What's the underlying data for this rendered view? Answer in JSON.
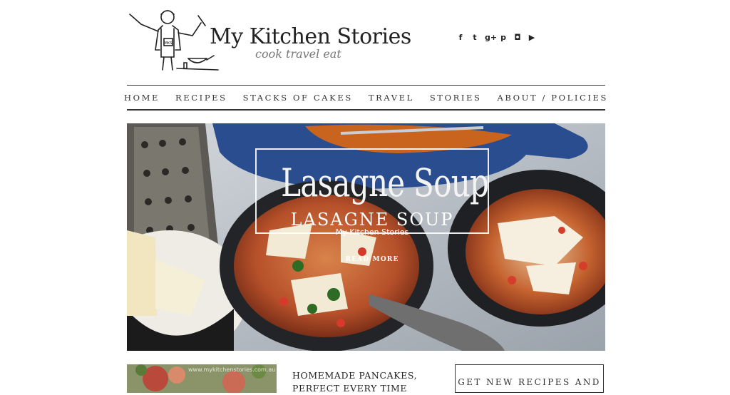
{
  "header": {
    "site_title": "My Kitchen Stories",
    "tagline": "cook travel eat",
    "logo_icon": "chef-illustration-icon",
    "apron_text": "MKS"
  },
  "social": [
    {
      "icon": "facebook-icon",
      "glyph": "f"
    },
    {
      "icon": "twitter-icon",
      "glyph": "t"
    },
    {
      "icon": "google-plus-icon",
      "glyph": "g+"
    },
    {
      "icon": "pinterest-icon",
      "glyph": "p"
    },
    {
      "icon": "instagram-icon",
      "glyph": "◘"
    },
    {
      "icon": "youtube-icon",
      "glyph": "▶"
    }
  ],
  "nav": {
    "items": [
      "HOME",
      "RECIPES",
      "STACKS OF CAKES",
      "TRAVEL",
      "STORIES",
      "ABOUT / POLICIES"
    ]
  },
  "hero": {
    "script_title": "Lasagne Soup",
    "title": "LASAGNE SOUP",
    "subtitle": "My Kitchen Stories",
    "cta": "READ MORE"
  },
  "bottom": {
    "thumb_watermark": "www.mykitchenstories.com.au",
    "post_title": "HOMEMADE PANCAKES, PERFECT EVERY TIME",
    "subscribe_label": "GET NEW RECIPES AND"
  },
  "colors": {
    "text": "#222222",
    "nav_border": "#333333",
    "tagline": "#777777",
    "pot_blue": "#2a4d8f",
    "soup": "#b8502a"
  }
}
